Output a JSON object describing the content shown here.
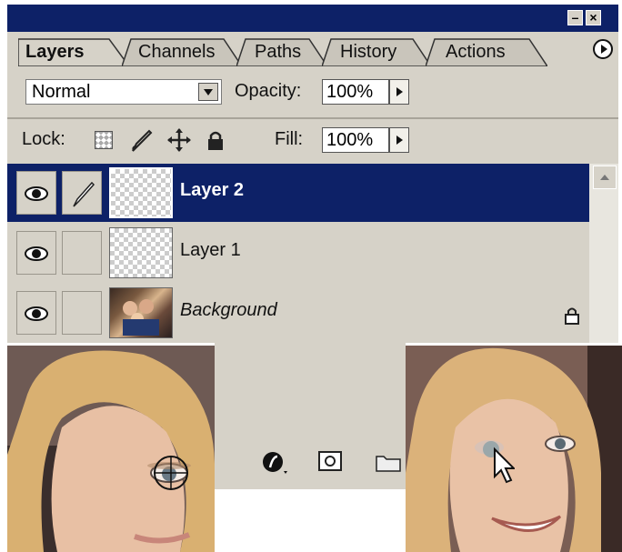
{
  "panel": {
    "tabs": [
      {
        "label": "Layers",
        "active": true
      },
      {
        "label": "Channels"
      },
      {
        "label": "Paths"
      },
      {
        "label": "History"
      },
      {
        "label": "Actions"
      }
    ],
    "blend_mode": "Normal",
    "opacity_label": "Opacity:",
    "opacity_value": "100%",
    "lock_label": "Lock:",
    "fill_label": "Fill:",
    "fill_value": "100%"
  },
  "layers": [
    {
      "name": "Layer 2",
      "selected": true
    },
    {
      "name": "Layer 1",
      "selected": false
    },
    {
      "name": "Background",
      "selected": false,
      "locked": true
    }
  ],
  "icons": [
    "minimize-icon",
    "close-icon",
    "panel-menu-icon",
    "eye-icon",
    "brush-icon",
    "lock-icon",
    "move-icon",
    "layer-style-icon",
    "mask-icon",
    "folder-icon",
    "crosshair-cursor-icon",
    "arrow-cursor-icon"
  ],
  "colors": {
    "selection": "#0d2167",
    "panel": "#d6d2c8"
  }
}
